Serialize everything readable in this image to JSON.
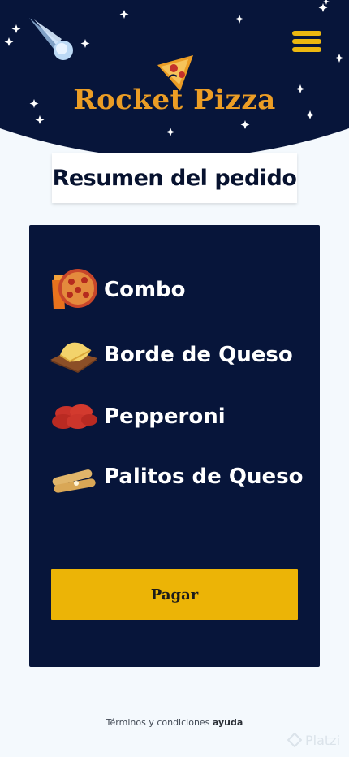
{
  "brand": {
    "name": "Rocket Pizza"
  },
  "page": {
    "title": "Resumen del pedido"
  },
  "order": {
    "items": [
      {
        "label": "Combo",
        "icon": "combo-pizza-icon"
      },
      {
        "label": "Borde de Queso",
        "icon": "cheese-board-icon"
      },
      {
        "label": "Pepperoni",
        "icon": "pepperoni-icon"
      },
      {
        "label": "Palitos de Queso",
        "icon": "cheese-sticks-icon"
      }
    ],
    "pay_label": "Pagar"
  },
  "footer": {
    "terms_label": "Términos y condiciones",
    "help_label": "ayuda"
  },
  "watermark": {
    "label": "Platzi"
  },
  "colors": {
    "navy": "#07153a",
    "accent": "#ecb406",
    "logo": "#eb9d25",
    "background": "#f4f9fd"
  }
}
